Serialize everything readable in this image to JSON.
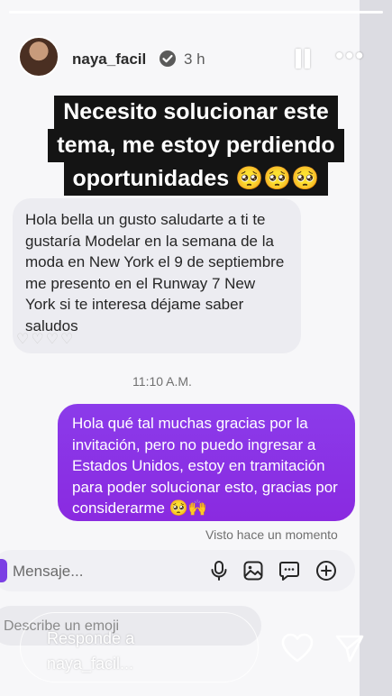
{
  "story": {
    "username": "naya_facil",
    "time_ago": "3 h",
    "progress_fraction": 1.0,
    "caption": {
      "line1": "Necesito solucionar este",
      "line2": "tema, me estoy perdiendo",
      "line3": "oportunidades 🥺🥺🥺"
    }
  },
  "chat": {
    "incoming_message": "Hola bella un gusto saludarte a ti te gustaría Modelar en la semana de la moda en New York el 9 de septiembre me presento en el Runway 7 New York si te interesa déjame saber saludos",
    "incoming_hearts": "♡♡♡♡",
    "timestamp": "11:10 A.M.",
    "outgoing_message": "Hola qué tal muchas gracias por la invitación, pero no puedo ingresar a Estados Unidos, estoy en tramitación para poder solucionar esto, gracias por considerarme 🥺🙌",
    "seen_status": "Visto hace un momento",
    "message_placeholder": "Mensaje...",
    "emoji_placeholder": "Describe un emoji"
  },
  "reply": {
    "placeholder_line1": "Responde a",
    "placeholder_line2": "naya_facil..."
  },
  "colors": {
    "accent_purple": "#8a2be2",
    "verified_blue": "#3897f0"
  },
  "icons": [
    "verified-icon",
    "pause-icon",
    "more-icon",
    "mic-icon",
    "image-icon",
    "sticker-icon",
    "plus-icon",
    "heart-icon",
    "send-icon"
  ]
}
